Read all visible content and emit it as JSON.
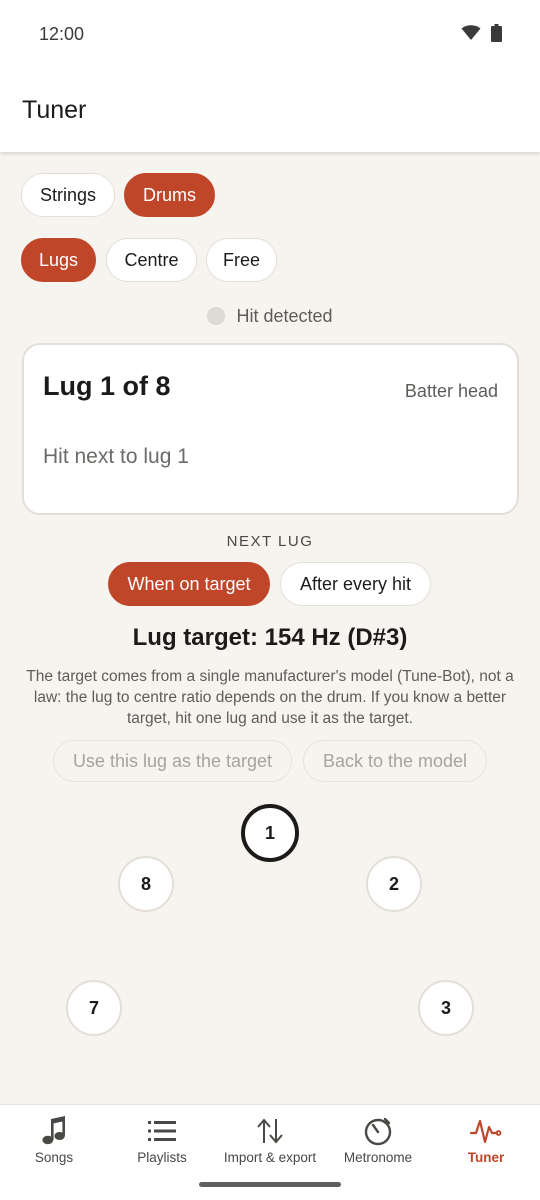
{
  "status_bar": {
    "time": "12:00"
  },
  "app_bar": {
    "title": "Tuner"
  },
  "instrument_tabs": [
    {
      "label": "Strings",
      "selected": false
    },
    {
      "label": "Drums",
      "selected": true
    }
  ],
  "mode_tabs": [
    {
      "label": "Lugs",
      "selected": true
    },
    {
      "label": "Centre",
      "selected": false
    },
    {
      "label": "Free",
      "selected": false
    }
  ],
  "hit_indicator": {
    "label": "Hit detected"
  },
  "lug_card": {
    "title": "Lug 1 of 8",
    "head": "Batter head",
    "hint": "Hit next to lug 1"
  },
  "next_lug": {
    "label": "NEXT LUG",
    "options": [
      {
        "label": "When on target",
        "selected": true
      },
      {
        "label": "After every hit",
        "selected": false
      }
    ]
  },
  "target": {
    "title": "Lug target: 154 Hz (D#3)",
    "note": "The target comes from a single manufacturer's model (Tune-Bot), not a law: the lug to centre ratio depends on the drum. If you know a better target, hit one lug and use it as the target.",
    "use_lug_label": "Use this lug as the target",
    "back_label": "Back to the model"
  },
  "lugs": [
    {
      "number": "1",
      "active": true
    },
    {
      "number": "2",
      "active": false
    },
    {
      "number": "3",
      "active": false
    },
    {
      "number": "7",
      "active": false
    },
    {
      "number": "8",
      "active": false
    }
  ],
  "bottom_nav": [
    {
      "label": "Songs",
      "icon": "music-note-icon",
      "active": false
    },
    {
      "label": "Playlists",
      "icon": "list-icon",
      "active": false
    },
    {
      "label": "Import & export",
      "icon": "import-export-icon",
      "active": false
    },
    {
      "label": "Metronome",
      "icon": "metronome-icon",
      "active": false
    },
    {
      "label": "Tuner",
      "icon": "tuner-wave-icon",
      "active": true
    }
  ],
  "colors": {
    "accent": "#c0462a",
    "background": "#f6f4ef",
    "surface": "#ffffff",
    "text": "#1c1b1a",
    "muted_text": "#5e5c58"
  }
}
